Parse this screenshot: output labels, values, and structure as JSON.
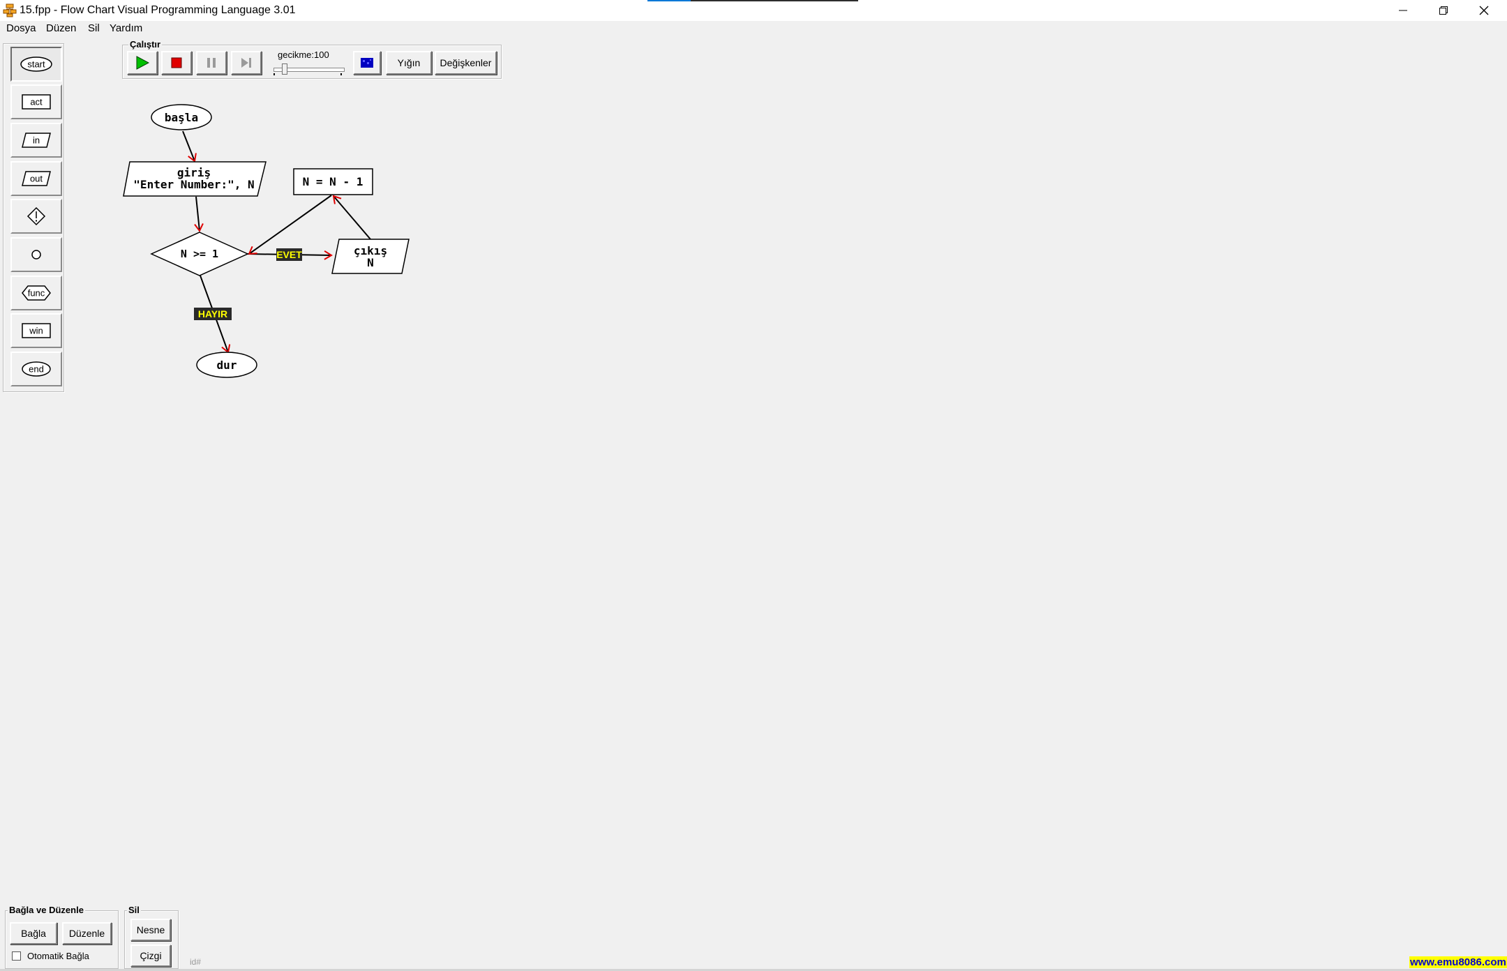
{
  "window": {
    "title": "15.fpp - Flow Chart Visual Programming Language 3.01"
  },
  "menu": [
    "Dosya",
    "Düzen",
    "Sil",
    "Yardım"
  ],
  "toolbox": {
    "items": [
      "start",
      "act",
      "in",
      "out",
      "",
      "",
      "func",
      "win",
      "end"
    ],
    "selected": "start"
  },
  "run_panel": {
    "title": "Çalıştır",
    "delay_label": "gecikme:100",
    "stack_button": "Yığın",
    "variables_button": "Değişkenler"
  },
  "flowchart": {
    "start_label": "başla",
    "input_lines": [
      "giriş",
      "\"Enter Number:\", N"
    ],
    "decision_label": "N >= 1",
    "action_label": "N = N - 1",
    "output_lines": [
      "çıkış",
      "N"
    ],
    "end_label": "dur",
    "yes_label": "EVET",
    "no_label": "HAYIR"
  },
  "connect_panel": {
    "title": "Bağla ve Düzenle",
    "connect_button": "Bağla",
    "edit_button": "Düzenle",
    "auto_connect_label": "Otomatik Bağla",
    "auto_connect_checked": false
  },
  "delete_panel": {
    "title": "Sil",
    "object_button": "Nesne",
    "line_button": "Çizgi"
  },
  "status": {
    "id_label": "id#",
    "brand": "www.emu8086.com"
  },
  "colors": {
    "play": "#00b000",
    "stop": "#e00000",
    "arrow_head": "#e00000",
    "label_bg": "#2a2a2a",
    "label_text": "#ffff00",
    "brand_bg": "#ffff00",
    "brand_text": "#0000cc"
  }
}
